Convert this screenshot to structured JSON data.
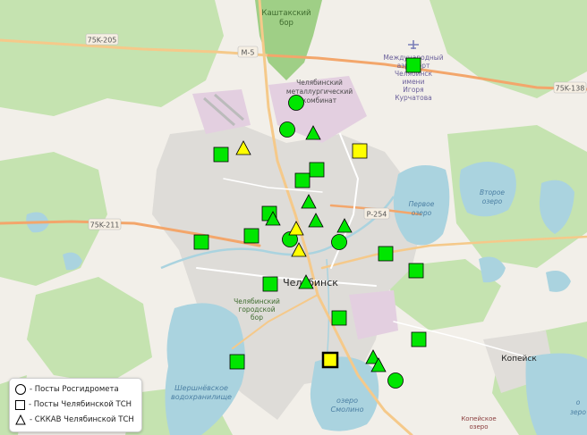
{
  "map": {
    "colors": {
      "land": "#f2efe9",
      "forest": "#b6dba0",
      "forest_dark": "#9fcf86",
      "water": "#aad3df",
      "urban": "#dcdcdc",
      "industrial": "#e2cbde",
      "road_major": "#f5c98a",
      "road_trunk": "#f3a66b",
      "marker_green": "#00e600",
      "marker_yellow": "#ffff00",
      "marker_stroke": "#000000"
    },
    "labels": {
      "city": "Челябинск",
      "kashtak_forest": [
        "Каштакский",
        "бор"
      ],
      "metallurgical": [
        "Челябинский",
        "металлургический",
        "комбинат"
      ],
      "airport": [
        "Международный",
        "аэропорт",
        "Челябинск",
        "имени",
        "Игоря",
        "Курчатова"
      ],
      "lake_first": [
        "Первое",
        "озеро"
      ],
      "lake_second": [
        "Второе",
        "озеро"
      ],
      "city_forest": [
        "Челябинский",
        "городской",
        "бор"
      ],
      "shershni": [
        "Шершнёвское",
        "водохранилище"
      ],
      "smolino": [
        "озеро",
        "Смолино"
      ],
      "kopeysk_lake": [
        "Копейское",
        "озеро"
      ],
      "kopeysk": "Копейск",
      "small_lake": [
        "о",
        "зеро"
      ]
    },
    "road_shields": {
      "r1": "75K-205",
      "r2": "M-5",
      "r3": "75K-138",
      "r4": "75K-211",
      "r5": "P-254"
    },
    "icons": {
      "airport": "airplane-icon"
    }
  },
  "legend": {
    "items": [
      {
        "symbol": "circle",
        "label": "- Посты Росгидромета"
      },
      {
        "symbol": "square",
        "label": "- Посты Челябинской ТСН"
      },
      {
        "symbol": "triangle",
        "label": "- СККАВ Челябинской ТСН"
      }
    ]
  },
  "stations": {
    "rosgidromet": [
      {
        "id": "c1",
        "color": "green"
      },
      {
        "id": "c2",
        "color": "green"
      },
      {
        "id": "c3",
        "color": "green"
      },
      {
        "id": "c4",
        "color": "green"
      },
      {
        "id": "c5",
        "color": "green"
      }
    ],
    "tsn_posts": [
      {
        "id": "s1",
        "color": "green"
      },
      {
        "id": "s2",
        "color": "green"
      },
      {
        "id": "s3",
        "color": "yellow"
      },
      {
        "id": "s4",
        "color": "green"
      },
      {
        "id": "s5",
        "color": "green"
      },
      {
        "id": "s6",
        "color": "green"
      },
      {
        "id": "s7",
        "color": "green"
      },
      {
        "id": "s8",
        "color": "green"
      },
      {
        "id": "s9",
        "color": "green"
      },
      {
        "id": "s10",
        "color": "green"
      },
      {
        "id": "s11",
        "color": "green"
      },
      {
        "id": "s12",
        "color": "green"
      },
      {
        "id": "s13",
        "color": "green"
      },
      {
        "id": "s14",
        "color": "green"
      },
      {
        "id": "s15",
        "color": "green"
      },
      {
        "id": "s16",
        "color": "yellow",
        "highlighted": true
      }
    ],
    "skkav": [
      {
        "id": "t1",
        "color": "yellow"
      },
      {
        "id": "t2",
        "color": "green"
      },
      {
        "id": "t3",
        "color": "green"
      },
      {
        "id": "t4",
        "color": "green"
      },
      {
        "id": "t5",
        "color": "green"
      },
      {
        "id": "t6",
        "color": "green"
      },
      {
        "id": "t7",
        "color": "yellow"
      },
      {
        "id": "t8",
        "color": "yellow"
      },
      {
        "id": "t9",
        "color": "green"
      },
      {
        "id": "t10",
        "color": "green"
      },
      {
        "id": "t11",
        "color": "green"
      }
    ]
  }
}
